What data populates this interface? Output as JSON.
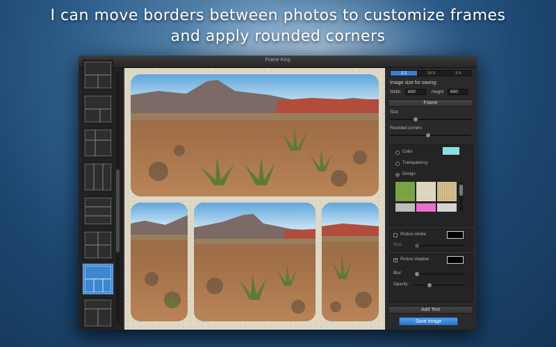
{
  "headline": {
    "line1": "I can move borders between photos to customize frames",
    "line2": "and apply rounded corners"
  },
  "window": {
    "title": "Frame King"
  },
  "panel": {
    "aspect_tabs": [
      "1:1",
      "16:9",
      "3:4"
    ],
    "active_aspect": "1:1",
    "image_size_label": "Image size for saving:",
    "width_label": "Width",
    "width_value": "600",
    "height_label": "Height",
    "height_value": "600",
    "frame_button": "Frame",
    "size_label": "Size",
    "size_level": 0.3,
    "rounded_label": "Rounded corners",
    "rounded_level": 0.45,
    "color_label": "Color",
    "color_swatch": "#7fe3e6",
    "transparency_label": "Transparency",
    "design_label": "Design",
    "selected_background": "Design",
    "textures": [
      "green-grass",
      "cream-linen",
      "sandy-beige",
      "gray-stone",
      "pink",
      "light-gray"
    ],
    "stroke_label": "Picture stroke",
    "stroke_checked": false,
    "stroke_swatch": "#000000",
    "stroke_size_label": "Size:",
    "shadow_label": "Picture shadow",
    "shadow_checked": true,
    "shadow_swatch": "#000000",
    "blur_label": "Blur:",
    "opacity_label": "Opacity:",
    "add_text_button": "Add Text",
    "save_button": "Save Image"
  },
  "colors": {
    "accent": "#3a7fd0",
    "canvas_paper": "#ddd6c4",
    "window_bg": "#2b2b2b"
  }
}
